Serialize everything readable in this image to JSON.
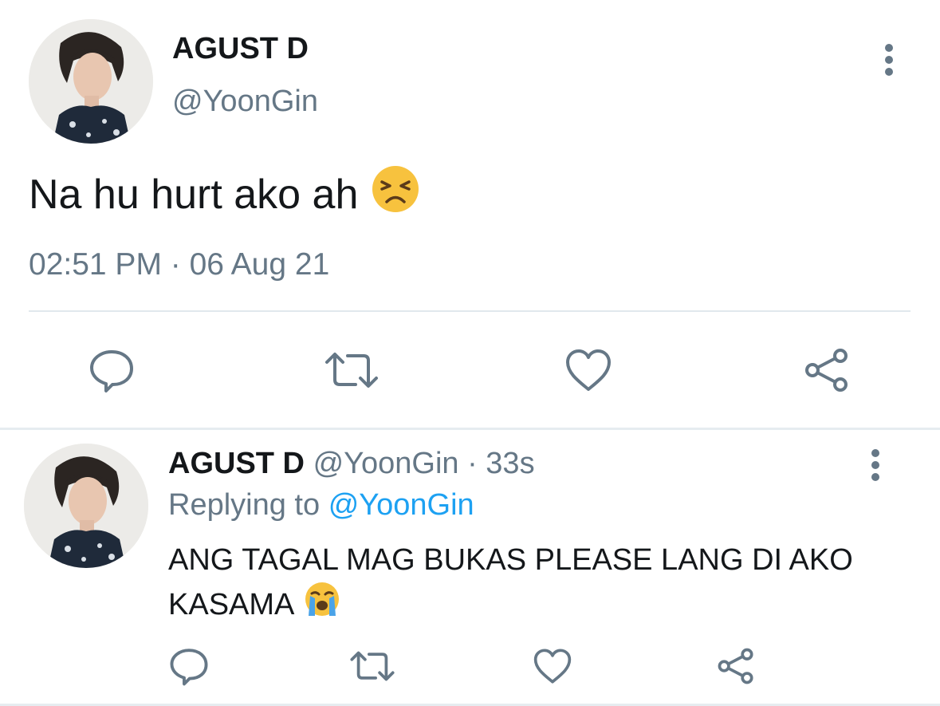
{
  "main_tweet": {
    "author_name": "AGUST D",
    "author_handle": "@YoonGin",
    "text": "Na hu hurt ako ah",
    "emoji": "tired-face-emoji",
    "timestamp": "02:51 PM · 06 Aug 21"
  },
  "reply_tweet": {
    "author_name": "AGUST D",
    "author_handle": "@YoonGin",
    "time_ago": " · 33s",
    "replying_label": "Replying to",
    "replying_to": "@YoonGin",
    "text_line1": "ANG TAGAL MAG BUKAS PLEASE LANG DI AKO",
    "text_line2": "KASAMA",
    "emoji": "loudly-crying-face-emoji"
  },
  "icons": {
    "reply": "reply-icon",
    "retweet": "retweet-icon",
    "like": "like-icon",
    "share": "share-icon",
    "more": "more-vertical-icon"
  },
  "colors": {
    "text": "#14171a",
    "secondary": "#657786",
    "link": "#1da1f2",
    "divider": "#e1e8ed"
  }
}
